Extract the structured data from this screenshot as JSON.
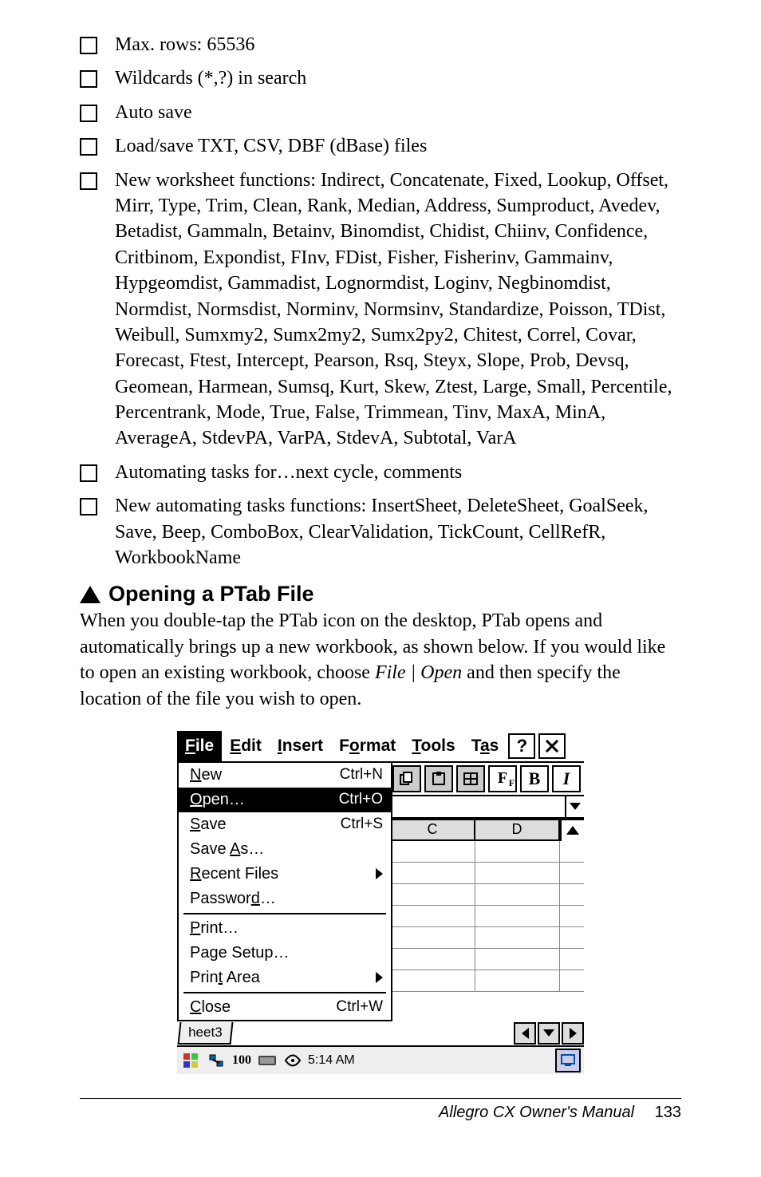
{
  "bullets": {
    "b0": "Max. rows: 65536",
    "b1": "Wildcards (*,?) in search",
    "b2": "Auto save",
    "b3": "Load/save TXT, CSV, DBF (dBase) files",
    "b4": "New worksheet functions: Indirect, Concatenate, Fixed, Lookup, Offset, Mirr, Type, Trim, Clean, Rank, Median, Address, Sumproduct, Avedev, Betadist, Gammaln, Betainv, Binomdist, Chidist, Chiinv, Confidence, Critbinom, Expondist, FInv, FDist, Fisher, Fisherinv, Gammainv, Hypgeomdist, Gammadist, Lognormdist, Loginv, Negbinomdist, Normdist, Normsdist, Norminv, Normsinv, Standardize, Poisson, TDist, Weibull, Sumxmy2, Sumx2my2, Sumx2py2, Chitest, Correl, Covar, Forecast, Ftest, Intercept, Pearson, Rsq, Steyx, Slope, Prob, Devsq, Geomean, Harmean, Sumsq, Kurt, Skew, Ztest, Large, Small, Percentile, Percentrank, Mode, True, False, Trimmean, Tinv, MaxA, MinA, AverageA, StdevPA, VarPA, StdevA, Subtotal, VarA",
    "b5": "Automating tasks for…next cycle, comments",
    "b6": "New automating tasks functions: InsertSheet, DeleteSheet, GoalSeek, Save, Beep, ComboBox, ClearValidation, TickCount, CellRefR, WorkbookName"
  },
  "heading": "Opening a PTab File",
  "intro_pre": "When you double-tap the PTab icon on the desktop, PTab opens and automatically brings up a new workbook, as shown below. If you would like to open an existing workbook, choose ",
  "intro_em": "File | Open",
  "intro_post": " and then specify the location of the file you wish to open.",
  "ptab": {
    "menubar": {
      "file_u": "F",
      "file_r": "ile",
      "edit_u": "E",
      "edit_r": "dit",
      "insert_u": "I",
      "insert_r": "nsert",
      "format_pre": "F",
      "format_u": "o",
      "format_r": "rmat",
      "tools_u": "T",
      "tools_r": "ools",
      "tasks_pre": "T",
      "tasks_u": "a",
      "tasks_r": "s",
      "help": "?"
    },
    "filemenu": {
      "new_u": "N",
      "new_r": "ew",
      "new_acc": "Ctrl+N",
      "open_u": "O",
      "open_r": "pen…",
      "open_acc": "Ctrl+O",
      "save_u": "S",
      "save_r": "ave",
      "save_acc": "Ctrl+S",
      "saveas_pre": "Save ",
      "saveas_u": "A",
      "saveas_r": "s…",
      "recent_u": "R",
      "recent_r": "ecent Files",
      "password_pre": "Passwor",
      "password_u": "d",
      "password_r": "…",
      "print_u": "P",
      "print_r": "rint…",
      "pagesetup_pre": "Pa",
      "pagesetup_u": "g",
      "pagesetup_r": "e Setup…",
      "printarea_pre": "Prin",
      "printarea_u": "t",
      "printarea_r": " Area",
      "close_u": "C",
      "close_r": "lose",
      "close_acc": "Ctrl+W"
    },
    "toolbar": {
      "font_label": "F",
      "font_sub": "F",
      "bold": "B",
      "italic": "I"
    },
    "cols": {
      "c": "C",
      "d": "D"
    },
    "sheet_tab": "heet3",
    "taskbar": {
      "calc": "100",
      "time": "5:14 AM"
    }
  },
  "footer": {
    "title": "Allegro CX Owner's Manual",
    "page": "133"
  }
}
